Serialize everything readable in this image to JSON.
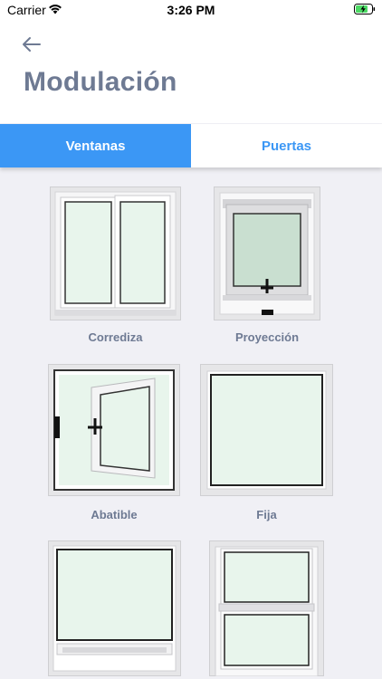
{
  "status_bar": {
    "carrier": "Carrier",
    "time": "3:26 PM"
  },
  "header": {
    "title": "Modulación"
  },
  "tabs": [
    {
      "label": "Ventanas",
      "active": true
    },
    {
      "label": "Puertas",
      "active": false
    }
  ],
  "items": [
    {
      "label": "Corrediza",
      "icon": "sliding-window-icon"
    },
    {
      "label": "Proyección",
      "icon": "projection-window-icon"
    },
    {
      "label": "Abatible",
      "icon": "casement-window-icon"
    },
    {
      "label": "Fija",
      "icon": "fixed-window-icon"
    },
    {
      "label": "",
      "icon": "window-with-vent-icon"
    },
    {
      "label": "",
      "icon": "double-hung-window-icon"
    }
  ],
  "colors": {
    "accent": "#3b97f5",
    "title": "#6e7a93",
    "background": "#f0f0f5",
    "glass": "#e8f5ec"
  }
}
